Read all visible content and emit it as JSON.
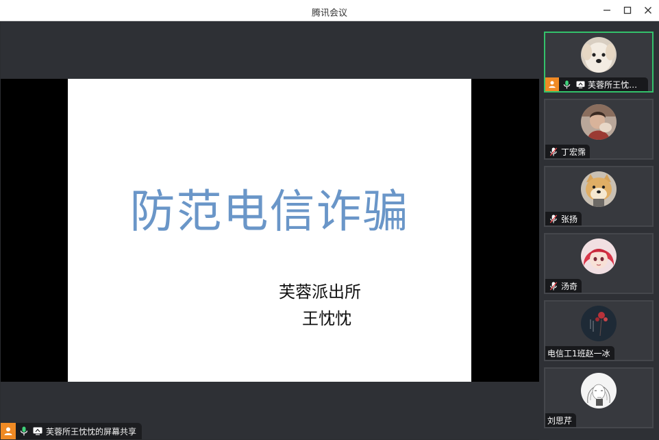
{
  "window": {
    "title": "腾讯会议"
  },
  "slide": {
    "title": "防范电信诈骗",
    "subtitle_org": "芙蓉派出所",
    "subtitle_name": "王忱忱"
  },
  "share_bar": {
    "label": "芙蓉所王忱忱的屏幕共享"
  },
  "participants": [
    {
      "name": "芙蓉所王忱忱...",
      "avatar": "dog-white-avatar",
      "mic": "on",
      "sharing": true,
      "host": true,
      "active": true
    },
    {
      "name": "丁宏霈",
      "avatar": "person-photo-avatar",
      "mic": "muted"
    },
    {
      "name": "张扬",
      "avatar": "shiba-dog-avatar",
      "mic": "muted"
    },
    {
      "name": "汤奇",
      "avatar": "anime-girl-avatar",
      "mic": "muted"
    },
    {
      "name": "电信工1班赵一冰",
      "avatar": "dark-art-avatar",
      "mic": "none"
    },
    {
      "name": "刘思芹",
      "avatar": "sketch-girl-avatar",
      "mic": "none"
    }
  ],
  "colors": {
    "active_border": "#33c26b",
    "host_badge": "#f08a24",
    "mic_on": "#3fd27a",
    "slide_title": "#6a96c8"
  },
  "icons": [
    "minimize-icon",
    "maximize-icon",
    "close-icon",
    "user-icon",
    "mic-icon",
    "mic-muted-icon",
    "screen-share-icon"
  ]
}
